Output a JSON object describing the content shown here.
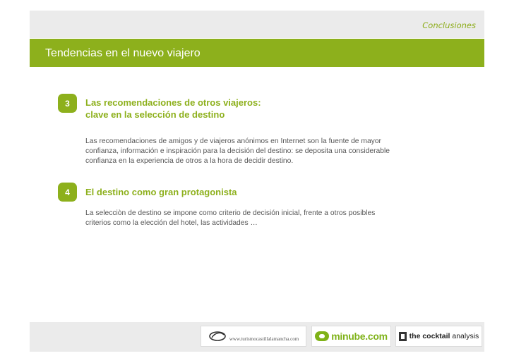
{
  "header": {
    "section": "Conclusiones",
    "title": "Tendencias en el nuevo viajero"
  },
  "items": [
    {
      "number": "3",
      "heading_line1": "Las recomendaciones de otros viajeros:",
      "heading_line2": "clave en la selección de destino",
      "body_line1": "Las recomendaciones  de amigos y de viajeros anónimos en Internet son la fuente de mayor",
      "body_line2": "confianza, información e inspiración para la decisión del destino: se deposita una considerable",
      "body_line3": "confianza en la experiencia  de otros a la hora de decidir destino."
    },
    {
      "number": "4",
      "heading_line1": "El destino como gran protagonista",
      "body_line1": "La selecciòn de destino se impone como criterio de decisión inicial, frente a otros posibles",
      "body_line2": "criterios como la elección del hotel, las actividades …"
    }
  ],
  "footer": {
    "logo_turismo": "www.turismocastillalamancha.com",
    "logo_minube": "minube.com",
    "logo_cocktail_bold": "the cocktail",
    "logo_cocktail_light": " analysis"
  },
  "colors": {
    "accent": "#8db01c",
    "band": "#ebebeb",
    "body_text": "#555555"
  }
}
